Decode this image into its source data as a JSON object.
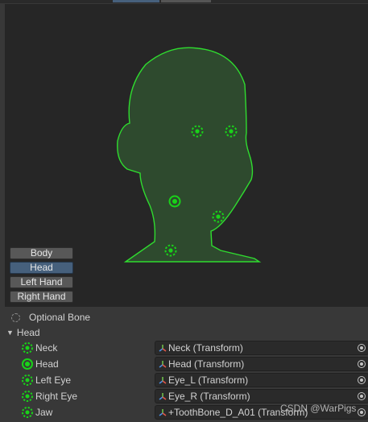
{
  "body_parts": {
    "buttons": [
      "Body",
      "Head",
      "Left Hand",
      "Right Hand"
    ],
    "selected": "Head"
  },
  "legend": {
    "optional_bone_label": "Optional Bone"
  },
  "group": {
    "label": "Head"
  },
  "bones": [
    {
      "label": "Neck",
      "value": "Neck (Transform)",
      "style": "dashed-circle-icon"
    },
    {
      "label": "Head",
      "value": "Head (Transform)",
      "style": "solid-circle-icon"
    },
    {
      "label": "Left Eye",
      "value": "Eye_L (Transform)",
      "style": "dashed-circle-icon"
    },
    {
      "label": "Right Eye",
      "value": "Eye_R (Transform)",
      "style": "dashed-circle-icon"
    },
    {
      "label": "Jaw",
      "value": "+ToothBone_D_A01 (Transform)",
      "style": "dashed-circle-icon"
    }
  ],
  "watermark": "CSDN @WarPigs",
  "colors": {
    "mapped_green": "#19d219",
    "head_fill": "#2e4a2e",
    "selected_button": "#46607c"
  }
}
